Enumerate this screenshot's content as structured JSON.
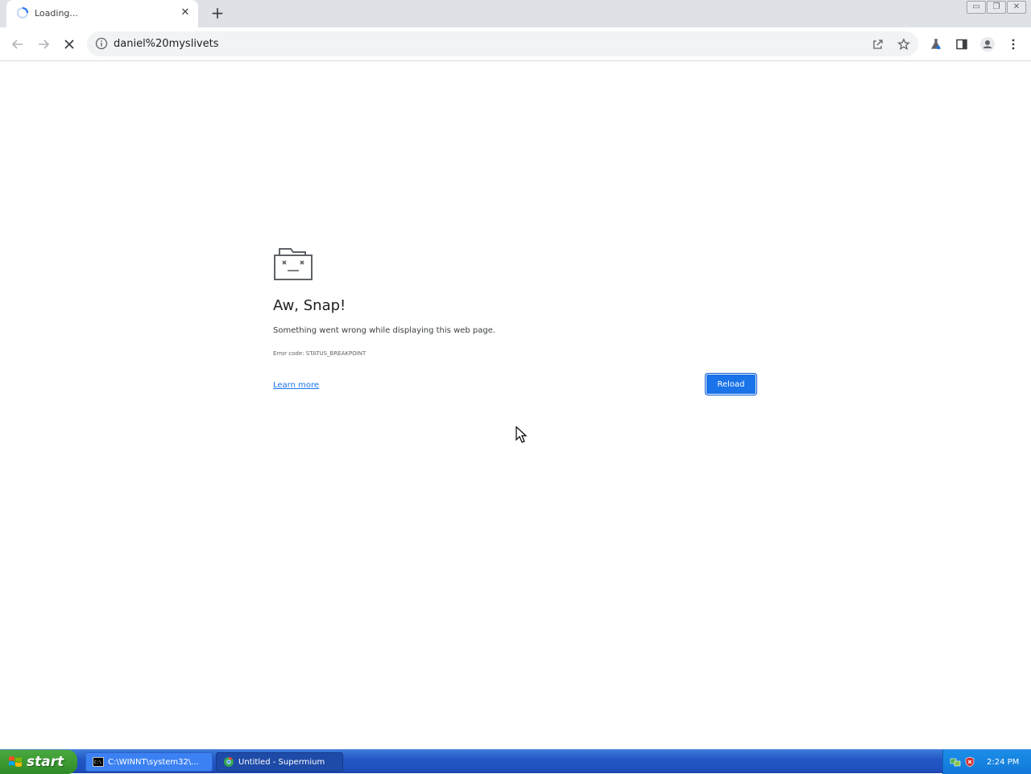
{
  "browser": {
    "tab": {
      "title": "Loading...",
      "close_label": "✕"
    },
    "new_tab_label": "+",
    "window_buttons": {
      "minimize": "▭",
      "restore": "❐",
      "close": "✕"
    },
    "address_bar": {
      "url": "daniel%20myslivets"
    },
    "icons": {
      "back": "arrow-left",
      "forward": "arrow-right",
      "stop": "x-mark",
      "site_info": "info-circle",
      "share": "share-box",
      "bookmark": "star",
      "labs": "beaker",
      "side_panel": "panel",
      "profile": "person-circle",
      "menu": "kebab"
    }
  },
  "error_page": {
    "heading": "Aw, Snap!",
    "message": "Something went wrong while displaying this web page.",
    "error_code": "Error code: STATUS_BREAKPOINT",
    "learn_more": "Learn more",
    "reload": "Reload"
  },
  "taskbar": {
    "start_label": "start",
    "items": [
      {
        "label": "C:\\WINNT\\system32\\...",
        "icon": "cmd-icon",
        "active": false
      },
      {
        "label": "Untitled - Supermium",
        "icon": "browser-icon",
        "active": true
      }
    ],
    "clock": "2:24 PM"
  },
  "colors": {
    "accent": "#1a73e8",
    "tabstrip": "#dee1e6",
    "taskbar": "#245edc",
    "start_button": "#3c9a33"
  }
}
